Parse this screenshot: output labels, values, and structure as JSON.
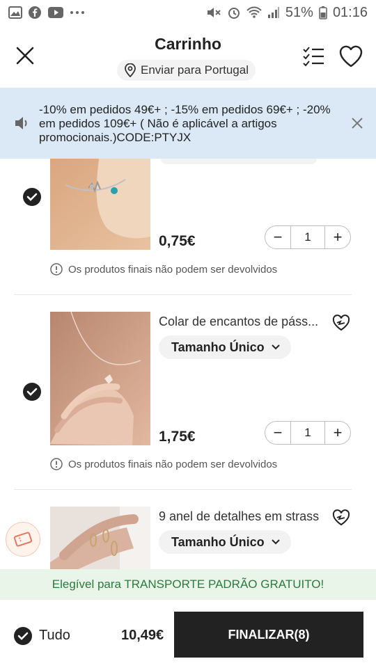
{
  "status_bar": {
    "battery": "51%",
    "time": "01:16"
  },
  "header": {
    "title": "Carrinho",
    "ship_to": "Enviar para Portugal"
  },
  "promo": {
    "text": "-10% em pedidos 49€+ ; -15% em pedidos 69€+ ; -20% em pedidos 109€+ ( Não é aplicável a artigos promocionais.)CODE:PTYJX"
  },
  "items": [
    {
      "name": "",
      "size": "",
      "price": "0,75€",
      "qty": "1",
      "notice": "Os produtos finais não podem ser devolvidos",
      "checked": true
    },
    {
      "name": "Colar de encantos de páss...",
      "size": "Tamanho Único",
      "price": "1,75€",
      "qty": "1",
      "notice": "Os produtos finais não podem ser devolvidos",
      "checked": true
    },
    {
      "name": "9 anel de detalhes em strass",
      "size": "Tamanho Único",
      "price": "",
      "qty": "",
      "notice": "",
      "checked": true
    }
  ],
  "free_shipping": "Elegível para TRANSPORTE PADRÃO GRATUITO!",
  "footer": {
    "all_label": "Tudo",
    "total": "10,49€",
    "checkout_label": "FINALIZAR(8)"
  },
  "colors": {
    "promo_bg": "#dbe9f7",
    "free_ship_bg": "#eaf5ea",
    "free_ship_text": "#2b7a3d",
    "checkout_bg": "#222222"
  }
}
